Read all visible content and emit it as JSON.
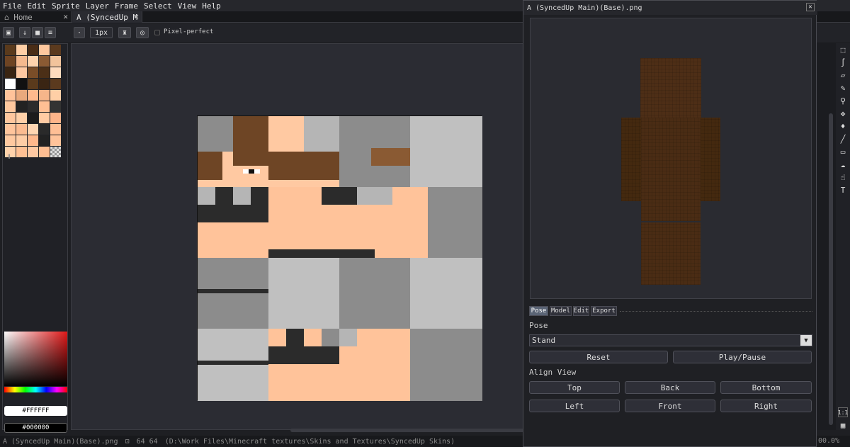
{
  "menu": [
    "File",
    "Edit",
    "Sprite",
    "Layer",
    "Frame",
    "Select",
    "View",
    "Help"
  ],
  "tabs": {
    "home_label": "⌂ Home",
    "home_close": "✕",
    "doc_label": "A (SyncedUp M",
    "doc_close": "✕"
  },
  "toolbar": {
    "brush_size": "1px",
    "dot_label": "·",
    "pixel_perfect_label": "Pixel-perfect"
  },
  "colors": {
    "foreground": "#FFFFFF",
    "background": "#000000"
  },
  "panel": {
    "title": "A (SyncedUp Main)(Base).png",
    "close": "✕",
    "tabs": [
      "Pose",
      "Model",
      "Edit",
      "Export"
    ],
    "pose_label": "Pose",
    "pose_value": "Stand",
    "reset": "Reset",
    "play_pause": "Play/Pause",
    "align_label": "Align View",
    "align_buttons": [
      "Top",
      "Back",
      "Bottom",
      "Left",
      "Front",
      "Right"
    ]
  },
  "status": {
    "filename": "A (SyncedUp Main)(Base).png",
    "size": "64 64",
    "path": "(D:\\Work Files\\Minecraft textures\\Skins and Textures\\SyncedUp Skins)",
    "zoom": "00.0%"
  },
  "rightbar": {
    "ratio_label": "1:1"
  }
}
